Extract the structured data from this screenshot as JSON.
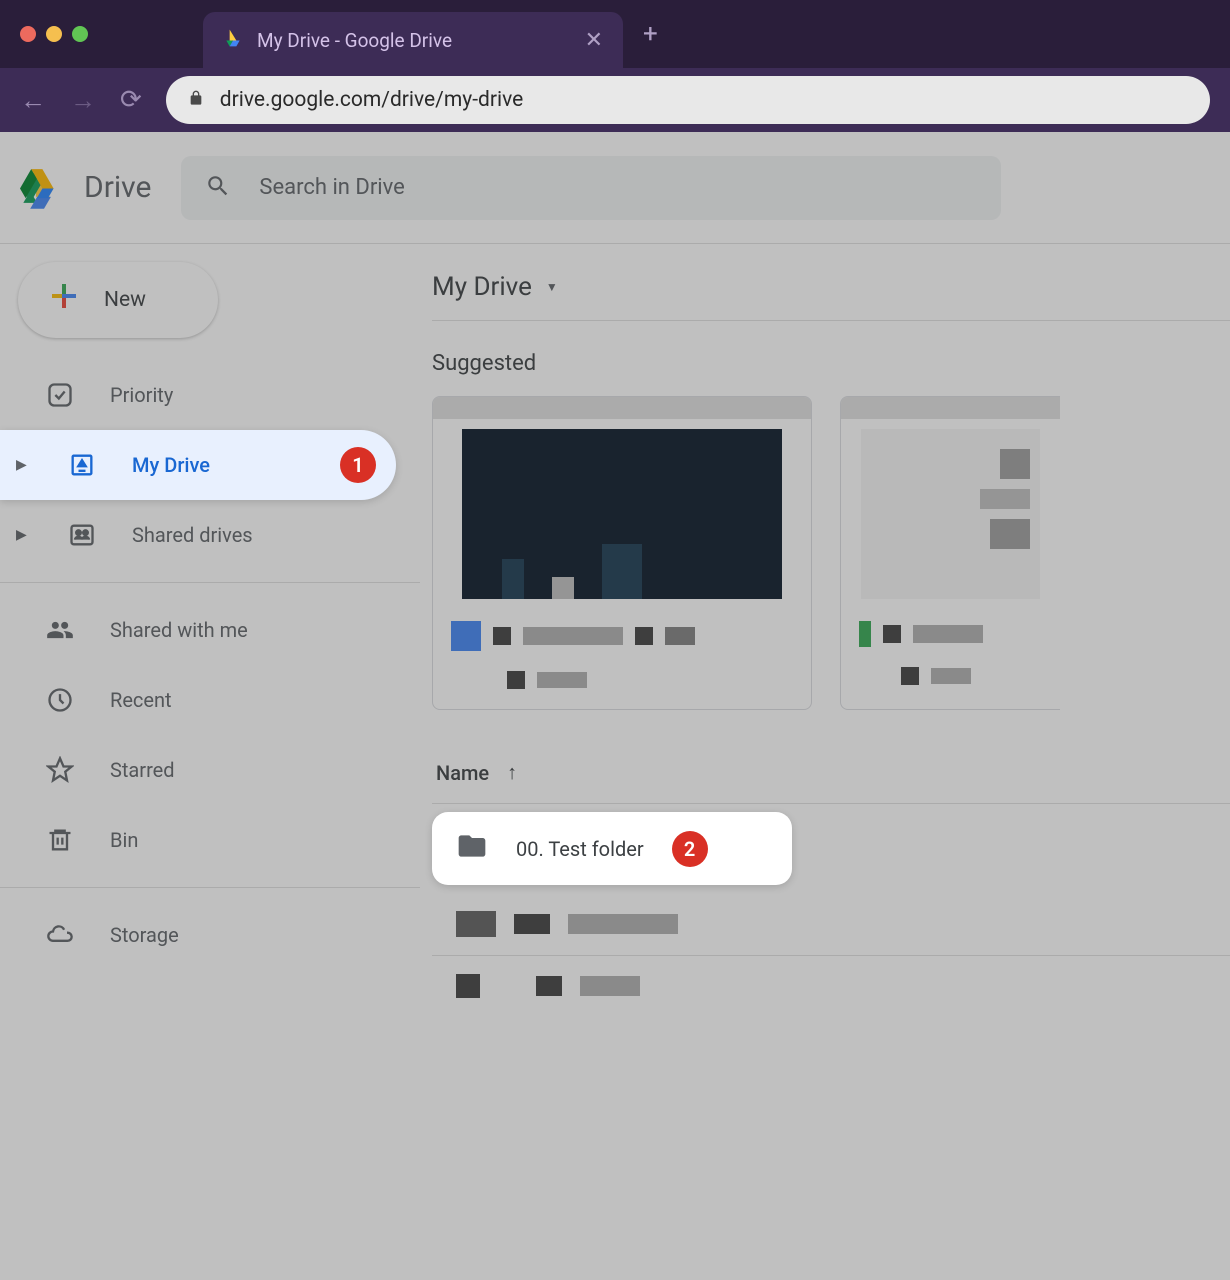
{
  "browser": {
    "tab_title": "My Drive - Google Drive",
    "url": "drive.google.com/drive/my-drive"
  },
  "header": {
    "app_name": "Drive",
    "search_placeholder": "Search in Drive"
  },
  "sidebar": {
    "new_label": "New",
    "items": [
      {
        "label": "Priority",
        "icon": "priority"
      },
      {
        "label": "My Drive",
        "icon": "my-drive",
        "active": true,
        "expandable": true,
        "callout": "1"
      },
      {
        "label": "Shared drives",
        "icon": "shared-drives",
        "expandable": true
      },
      {
        "label": "Shared with me",
        "icon": "shared-with-me"
      },
      {
        "label": "Recent",
        "icon": "recent"
      },
      {
        "label": "Starred",
        "icon": "starred"
      },
      {
        "label": "Bin",
        "icon": "bin"
      },
      {
        "label": "Storage",
        "icon": "storage"
      }
    ]
  },
  "main": {
    "breadcrumb": "My Drive",
    "suggested_title": "Suggested",
    "name_column": "Name",
    "folders": [
      {
        "name": "00. Test folder",
        "callout": "2",
        "highlighted": true
      }
    ]
  }
}
